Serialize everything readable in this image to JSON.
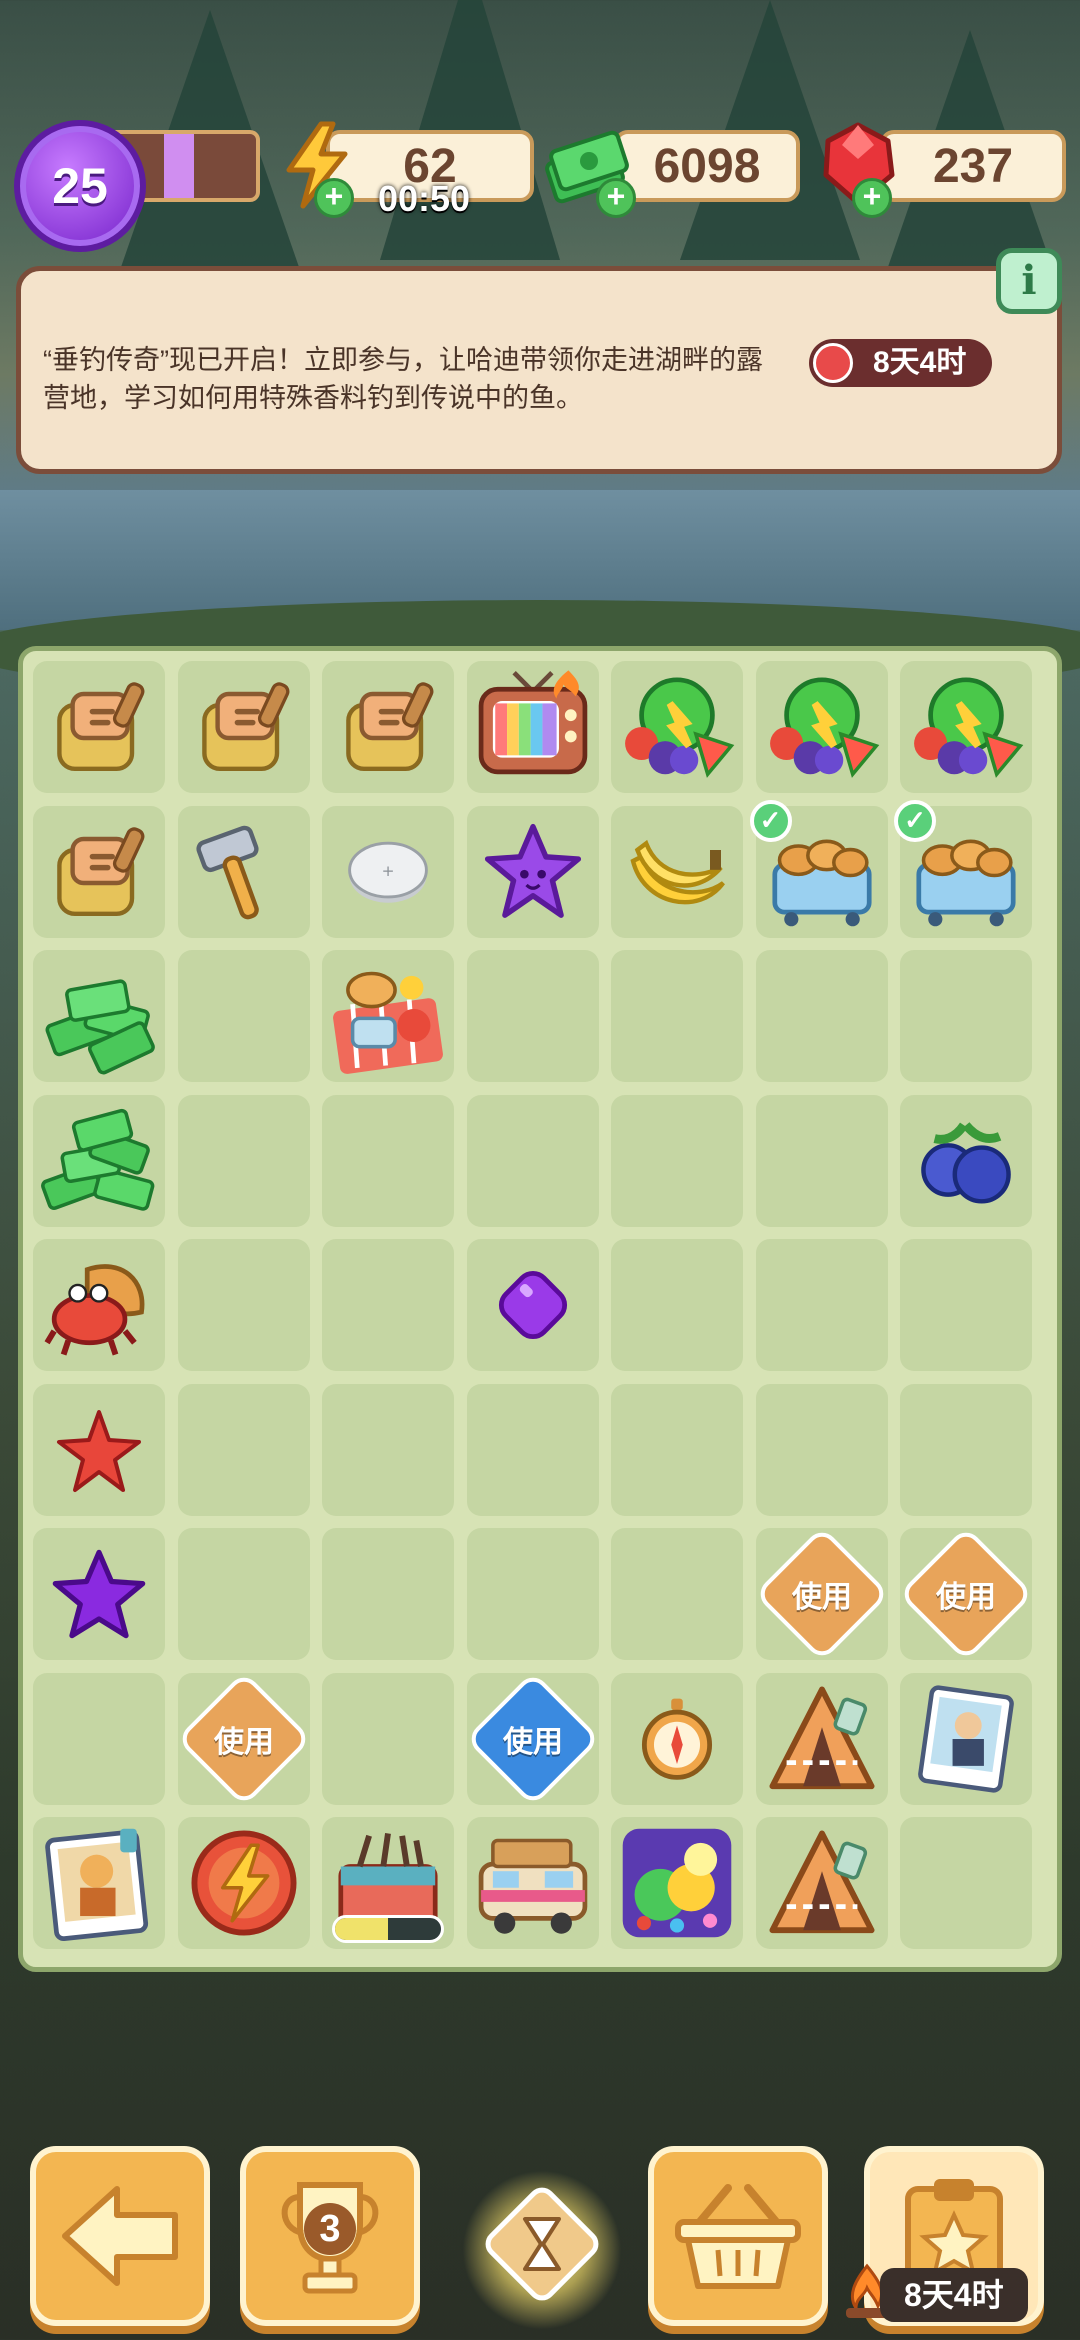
{
  "header": {
    "level": "25",
    "level_progress": 0.2,
    "energy": "62",
    "energy_timer": "00:50",
    "cash": "6098",
    "gems": "237"
  },
  "event": {
    "description": "“垂钓传奇”现已开启！立即参与，让哈迪带领你走进湖畔的露营地，学习如何用特殊香料钓到传说中的鱼。",
    "time_left": "8天4时",
    "info_icon": "info-icon"
  },
  "board": {
    "use_label": "使用",
    "progress_value": 0.5,
    "items": [
      {
        "row": 0,
        "col": 0,
        "icon": "backpack"
      },
      {
        "row": 0,
        "col": 1,
        "icon": "backpack"
      },
      {
        "row": 0,
        "col": 2,
        "icon": "backpack"
      },
      {
        "row": 0,
        "col": 3,
        "icon": "tv"
      },
      {
        "row": 0,
        "col": 4,
        "icon": "fruit-basket"
      },
      {
        "row": 0,
        "col": 5,
        "icon": "fruit-basket"
      },
      {
        "row": 0,
        "col": 6,
        "icon": "fruit-basket"
      },
      {
        "row": 1,
        "col": 0,
        "icon": "backpack"
      },
      {
        "row": 1,
        "col": 1,
        "icon": "hammer"
      },
      {
        "row": 1,
        "col": 2,
        "icon": "coin"
      },
      {
        "row": 1,
        "col": 3,
        "icon": "purple-star"
      },
      {
        "row": 1,
        "col": 4,
        "icon": "banana"
      },
      {
        "row": 1,
        "col": 5,
        "icon": "bread-cart",
        "check": true
      },
      {
        "row": 1,
        "col": 6,
        "icon": "bread-cart",
        "check": true
      },
      {
        "row": 2,
        "col": 0,
        "icon": "cash-pile"
      },
      {
        "row": 2,
        "col": 2,
        "icon": "picnic"
      },
      {
        "row": 3,
        "col": 0,
        "icon": "cash-heap"
      },
      {
        "row": 3,
        "col": 6,
        "icon": "blueberry"
      },
      {
        "row": 4,
        "col": 0,
        "icon": "hermit-crab"
      },
      {
        "row": 4,
        "col": 3,
        "icon": "purple-gem"
      },
      {
        "row": 5,
        "col": 0,
        "icon": "starfish"
      },
      {
        "row": 6,
        "col": 0,
        "icon": "purple-star-2"
      },
      {
        "row": 6,
        "col": 5,
        "icon": "use-tag-orange"
      },
      {
        "row": 6,
        "col": 6,
        "icon": "use-tag-orange"
      },
      {
        "row": 7,
        "col": 1,
        "icon": "use-tag-orange"
      },
      {
        "row": 7,
        "col": 3,
        "icon": "use-tag-blue"
      },
      {
        "row": 7,
        "col": 4,
        "icon": "compass"
      },
      {
        "row": 7,
        "col": 5,
        "icon": "tent"
      },
      {
        "row": 7,
        "col": 6,
        "icon": "photo-man"
      },
      {
        "row": 8,
        "col": 0,
        "icon": "photo-girl"
      },
      {
        "row": 8,
        "col": 1,
        "icon": "energy-orb"
      },
      {
        "row": 8,
        "col": 2,
        "icon": "toolbox",
        "progress": true
      },
      {
        "row": 8,
        "col": 3,
        "icon": "camper-van"
      },
      {
        "row": 8,
        "col": 4,
        "icon": "treasure"
      },
      {
        "row": 8,
        "col": 5,
        "icon": "tent"
      }
    ]
  },
  "nav": {
    "back_icon": "arrow-left-icon",
    "trophy_count": "3",
    "hourglass_icon": "hourglass-icon",
    "basket_icon": "basket-icon",
    "clipboard_icon": "clipboard-star-icon",
    "time_left": "8天4时"
  }
}
